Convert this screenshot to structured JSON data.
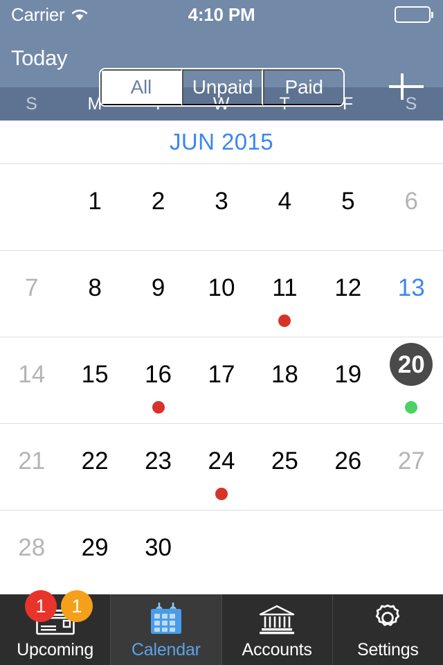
{
  "status_bar": {
    "carrier": "Carrier",
    "wifi_icon": "wifi-icon",
    "time": "4:10 PM",
    "battery_icon": "battery-full-icon"
  },
  "nav_bar": {
    "today_label": "Today",
    "add_icon": "plus-icon",
    "segments": [
      {
        "label": "All",
        "selected": true
      },
      {
        "label": "Unpaid",
        "selected": false
      },
      {
        "label": "Paid",
        "selected": false
      }
    ]
  },
  "calendar": {
    "weekdays": [
      {
        "label": "S",
        "weekend": true
      },
      {
        "label": "M",
        "weekend": false
      },
      {
        "label": "T",
        "weekend": false
      },
      {
        "label": "W",
        "weekend": false
      },
      {
        "label": "T",
        "weekend": false
      },
      {
        "label": "F",
        "weekend": false
      },
      {
        "label": "S",
        "weekend": true
      }
    ],
    "month_label": "JUN 2015",
    "today_date": "13",
    "selected_date": "20",
    "colors": {
      "month_blue": "#3b86f0",
      "today_blue": "#3b86f0",
      "selected_circle": "#4a4a4a",
      "muted_day": "#b4b4b4",
      "unpaid_dot": "#d8332a",
      "paid_dot": "#4cd264"
    },
    "weeks": [
      [
        {
          "day": "",
          "state": "empty",
          "dot": ""
        },
        {
          "day": "1",
          "state": "normal",
          "dot": ""
        },
        {
          "day": "2",
          "state": "normal",
          "dot": ""
        },
        {
          "day": "3",
          "state": "normal",
          "dot": ""
        },
        {
          "day": "4",
          "state": "normal",
          "dot": ""
        },
        {
          "day": "5",
          "state": "normal",
          "dot": ""
        },
        {
          "day": "6",
          "state": "muted",
          "dot": ""
        }
      ],
      [
        {
          "day": "7",
          "state": "muted",
          "dot": ""
        },
        {
          "day": "8",
          "state": "normal",
          "dot": ""
        },
        {
          "day": "9",
          "state": "normal",
          "dot": ""
        },
        {
          "day": "10",
          "state": "normal",
          "dot": ""
        },
        {
          "day": "11",
          "state": "normal",
          "dot": "#d8332a"
        },
        {
          "day": "12",
          "state": "normal",
          "dot": ""
        },
        {
          "day": "13",
          "state": "today",
          "dot": ""
        }
      ],
      [
        {
          "day": "14",
          "state": "muted",
          "dot": ""
        },
        {
          "day": "15",
          "state": "normal",
          "dot": ""
        },
        {
          "day": "16",
          "state": "normal",
          "dot": "#d8332a"
        },
        {
          "day": "17",
          "state": "normal",
          "dot": ""
        },
        {
          "day": "18",
          "state": "normal",
          "dot": ""
        },
        {
          "day": "19",
          "state": "normal",
          "dot": ""
        },
        {
          "day": "20",
          "state": "selected",
          "dot": "#4cd264"
        }
      ],
      [
        {
          "day": "21",
          "state": "muted",
          "dot": ""
        },
        {
          "day": "22",
          "state": "normal",
          "dot": ""
        },
        {
          "day": "23",
          "state": "normal",
          "dot": ""
        },
        {
          "day": "24",
          "state": "normal",
          "dot": "#d8332a"
        },
        {
          "day": "25",
          "state": "normal",
          "dot": ""
        },
        {
          "day": "26",
          "state": "normal",
          "dot": ""
        },
        {
          "day": "27",
          "state": "muted",
          "dot": ""
        }
      ],
      [
        {
          "day": "28",
          "state": "muted",
          "dot": ""
        },
        {
          "day": "29",
          "state": "normal",
          "dot": ""
        },
        {
          "day": "30",
          "state": "normal",
          "dot": ""
        },
        {
          "day": "",
          "state": "empty",
          "dot": ""
        },
        {
          "day": "",
          "state": "empty",
          "dot": ""
        },
        {
          "day": "",
          "state": "empty",
          "dot": ""
        },
        {
          "day": "",
          "state": "empty",
          "dot": ""
        }
      ]
    ]
  },
  "tab_bar": {
    "tabs": [
      {
        "label": "Upcoming",
        "icon": "checkbook-icon",
        "active": false,
        "badges": [
          {
            "count": "1",
            "color": "#e8342a"
          },
          {
            "count": "1",
            "color": "#f5a01b"
          }
        ]
      },
      {
        "label": "Calendar",
        "icon": "calendar-icon",
        "active": true,
        "badges": []
      },
      {
        "label": "Accounts",
        "icon": "bank-icon",
        "active": false,
        "badges": []
      },
      {
        "label": "Settings",
        "icon": "gear-icon",
        "active": false,
        "badges": []
      }
    ]
  }
}
